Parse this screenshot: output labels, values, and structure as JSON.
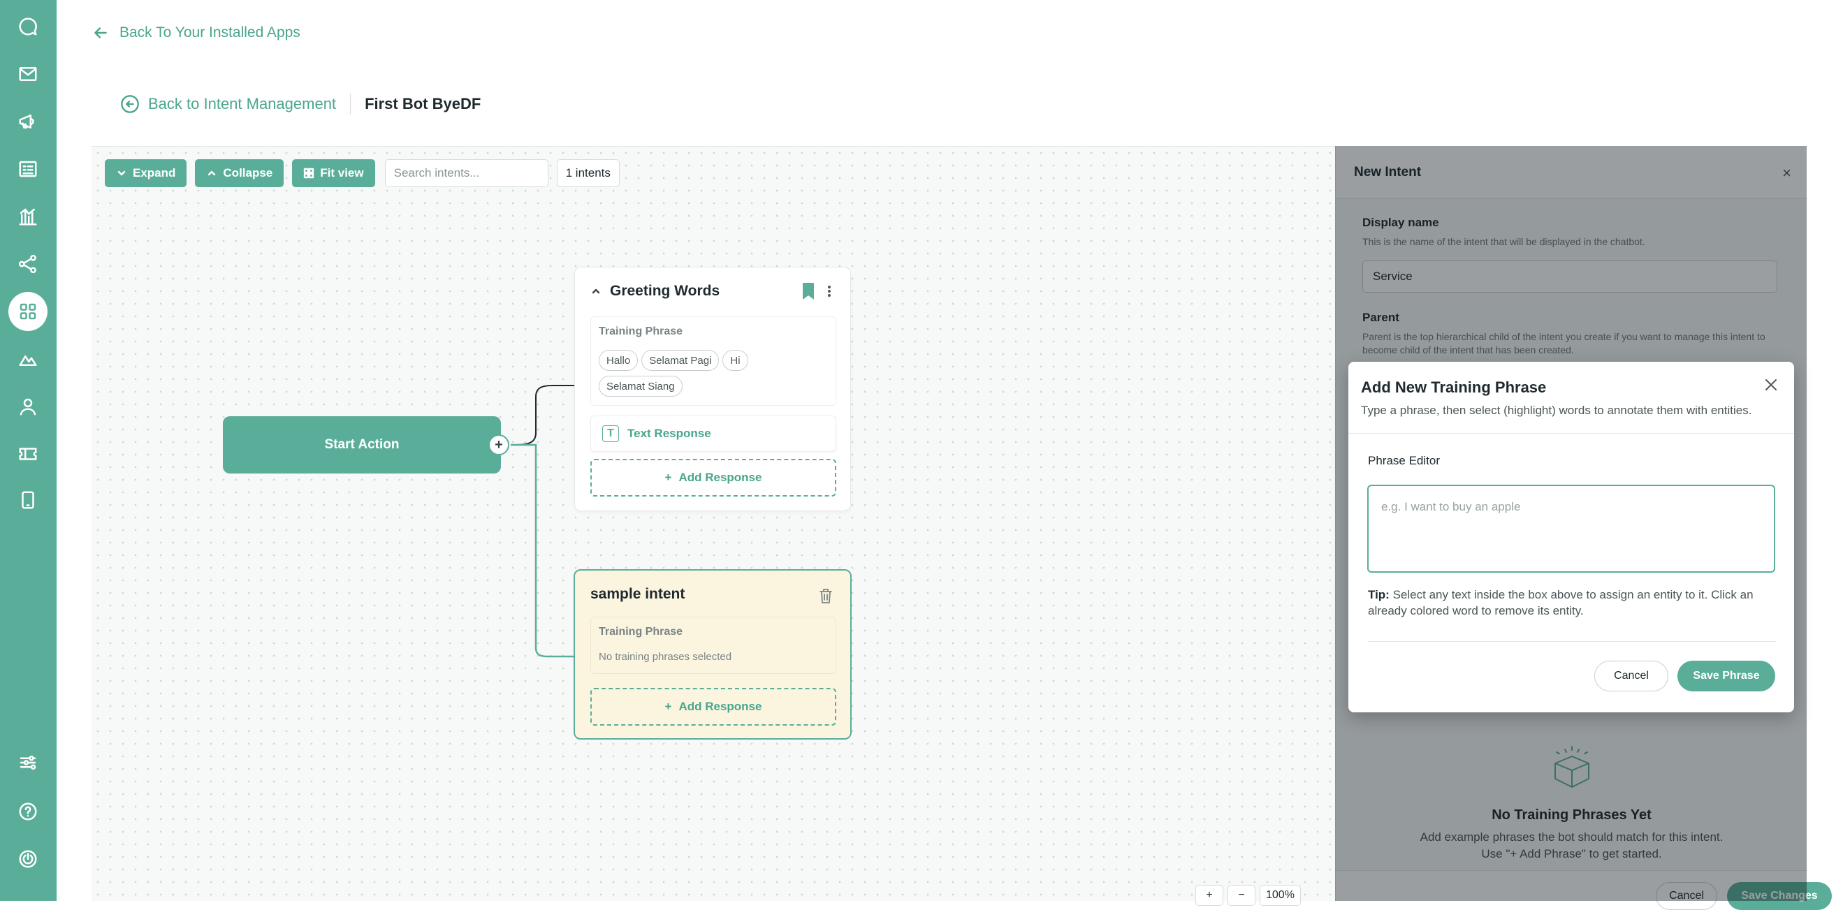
{
  "nav": {
    "back_to_apps": "Back To Your Installed Apps",
    "back_to_intents": "Back to Intent Management",
    "bot_name": "First Bot ByeDF"
  },
  "sidebar": {
    "icons": [
      "chat-icon",
      "mail-icon",
      "megaphone-icon",
      "contact-card-icon",
      "analytics-icon",
      "share-nodes-icon",
      "apps-grid-icon",
      "landscape-icon",
      "user-icon",
      "ticket-icon",
      "mobile-icon",
      "settings-sliders-icon",
      "help-icon",
      "power-icon"
    ],
    "active": "apps-grid-icon"
  },
  "toolbar": {
    "expand": "Expand",
    "collapse": "Collapse",
    "fit_view": "Fit view",
    "search_placeholder": "Search intents...",
    "count": "1 intents"
  },
  "canvas": {
    "start_node": "Start Action",
    "plus": "+",
    "zoom": {
      "in": "+",
      "out": "−",
      "level": "100%"
    }
  },
  "greeting_card": {
    "title": "Greeting Words",
    "training_label": "Training Phrase",
    "phrases": [
      "Hallo",
      "Selamat Pagi",
      "Hi",
      "Selamat Siang"
    ],
    "response_label": "Text Response",
    "add_response": "Add Response"
  },
  "sample_card": {
    "title": "sample intent",
    "training_label": "Training Phrase",
    "empty_text": "No training phrases selected",
    "add_response": "Add Response"
  },
  "panel": {
    "title": "New Intent",
    "display_name_label": "Display name",
    "display_name_help": "This is the name of the intent that will be displayed in the chatbot.",
    "display_name_value": "Service",
    "parent_label": "Parent",
    "parent_help": "Parent is the top hierarchical child of the intent you create if you want to manage this intent to become child of the intent that has been created.",
    "empty_title": "No Training Phrases Yet",
    "empty_sub_1": "Add example phrases the bot should match for this intent.",
    "empty_sub_2": "Use \"+ Add Phrase\" to get started.",
    "cancel": "Cancel",
    "save": "Save Changes"
  },
  "modal": {
    "title": "Add New Training Phrase",
    "subtitle": "Type a phrase, then select (highlight) words to annotate them with entities.",
    "editor_label": "Phrase Editor",
    "editor_placeholder": "e.g. I want to buy an apple",
    "tip_label": "Tip:",
    "tip_text": "Select any text inside the box above to assign an entity to it. Click an already colored word to remove its entity.",
    "cancel": "Cancel",
    "save": "Save Phrase"
  },
  "colors": {
    "accent": "#5aae99",
    "accent_text": "#4aa58d",
    "sample_bg": "#fbf5df"
  }
}
